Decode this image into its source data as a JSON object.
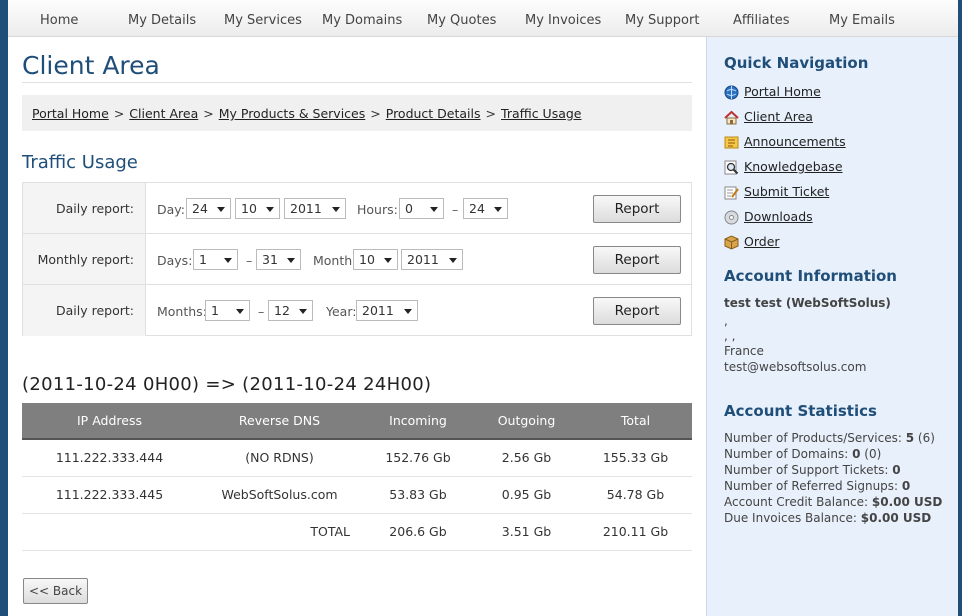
{
  "nav": [
    "Home",
    "My Details",
    "My Services",
    "My Domains",
    "My Quotes",
    "My Invoices",
    "My Support",
    "Affiliates",
    "My Emails"
  ],
  "page_title": "Client Area",
  "breadcrumb": [
    "Portal Home",
    "Client Area",
    "My Products & Services",
    "Product Details",
    "Traffic Usage"
  ],
  "breadcrumb_sep": ">",
  "section_title": "Traffic Usage",
  "reports": [
    {
      "label": "Daily report:",
      "texts": [
        "Day:",
        "Hours:",
        "–"
      ],
      "selects": [
        "24",
        "10",
        "2011",
        "0",
        "24"
      ],
      "button": "Report"
    },
    {
      "label": "Monthly report:",
      "texts": [
        "Days:",
        "–",
        "Month:"
      ],
      "selects": [
        "1",
        "31",
        "10",
        "2011"
      ],
      "button": "Report"
    },
    {
      "label": "Daily report:",
      "texts": [
        "Months:",
        "–",
        "Year:"
      ],
      "selects": [
        "1",
        "12",
        "2011"
      ],
      "button": "Report"
    }
  ],
  "range_title": "(2011-10-24 0H00) => (2011-10-24 24H00)",
  "table": {
    "headers": [
      "IP Address",
      "Reverse DNS",
      "Incoming",
      "Outgoing",
      "Total"
    ],
    "rows": [
      [
        "111.222.333.444",
        "(NO RDNS)",
        "152.76 Gb",
        "2.56 Gb",
        "155.33 Gb"
      ],
      [
        "111.222.333.445",
        "WebSoftSolus.com",
        "53.83 Gb",
        "0.95 Gb",
        "54.78 Gb"
      ],
      [
        "",
        "TOTAL",
        "206.6 Gb",
        "3.51 Gb",
        "210.11 Gb"
      ]
    ]
  },
  "back_button": "<< Back",
  "sidebar": {
    "quick_nav_title": "Quick Navigation",
    "quick_nav": [
      {
        "label": "Portal Home",
        "icon": "globe-icon"
      },
      {
        "label": "Client Area",
        "icon": "house-icon"
      },
      {
        "label": "Announcements",
        "icon": "announcement-icon"
      },
      {
        "label": "Knowledgebase",
        "icon": "magnifier-icon"
      },
      {
        "label": "Submit Ticket",
        "icon": "ticket-icon"
      },
      {
        "label": "Downloads",
        "icon": "disc-icon"
      },
      {
        "label": "Order",
        "icon": "box-icon"
      }
    ],
    "account_title": "Account Information",
    "account": {
      "name": "test test (WebSoftSolus)",
      "line1": ",",
      "line2": ", ,",
      "country": "France",
      "email": "test@websoftsolus.com"
    },
    "stats_title": "Account Statistics",
    "stats": [
      {
        "label": "Number of Products/Services:",
        "value": "5",
        "extra": "(6)"
      },
      {
        "label": "Number of Domains:",
        "value": "0",
        "extra": "(0)"
      },
      {
        "label": "Number of Support Tickets:",
        "value": "0",
        "extra": ""
      },
      {
        "label": "Number of Referred Signups:",
        "value": "0",
        "extra": ""
      },
      {
        "label": "Account Credit Balance:",
        "value": "$0.00 USD",
        "extra": ""
      },
      {
        "label": "Due Invoices Balance:",
        "value": "$0.00 USD",
        "extra": ""
      }
    ]
  },
  "colors": {
    "frame": "#1f4e79",
    "sidebar_bg": "#e8f1fb",
    "table_header": "#7f7f7f"
  }
}
